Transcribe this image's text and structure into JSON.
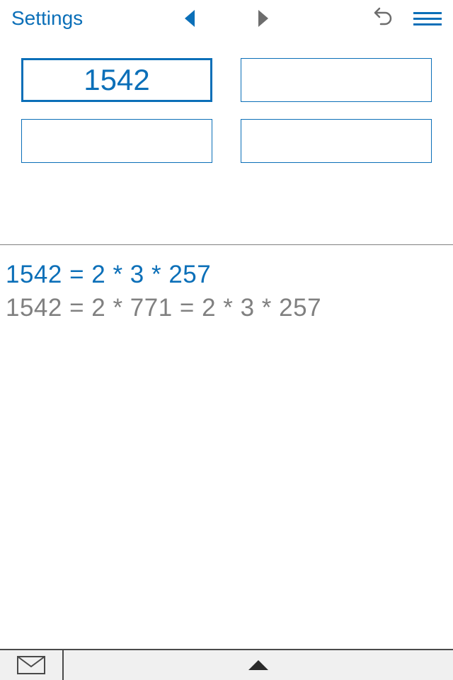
{
  "header": {
    "settings_label": "Settings"
  },
  "inputs": {
    "box1": "1542",
    "box2": "",
    "box3": "",
    "box4": ""
  },
  "results": {
    "primary": "1542 = 2  *  3  *  257",
    "secondary": "1542 = 2 * 771 = 2 * 3 * 257"
  },
  "colors": {
    "accent": "#0b6fb8",
    "muted": "#808080"
  }
}
